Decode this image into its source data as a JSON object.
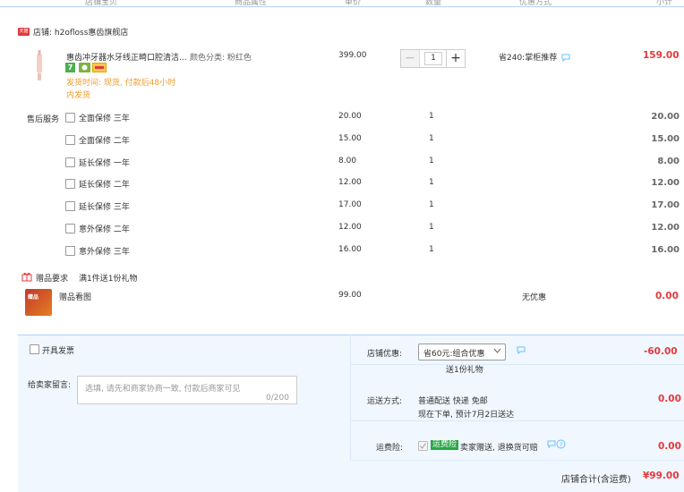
{
  "header": {
    "cols": [
      "店铺宝贝",
      "商品属性",
      "单价",
      "数量",
      "优惠方式",
      "小计"
    ]
  },
  "shop": {
    "badge": "天猫",
    "label": "店铺: h2ofloss惠齿旗舰店"
  },
  "product": {
    "title": "惠齿冲牙器水牙线正畸口腔清洁...",
    "attr": "颜色分类: 粉红色",
    "price": "399.00",
    "quantity": "1",
    "discount": "省240:掌柜推荐",
    "subtotal": "159.00",
    "ship_time": "发货时间: 现货, 付款后48小时",
    "ship_time_2": "内发货",
    "icon_names": [
      "7-day-return-icon",
      "guarantee-icon",
      "card-icon"
    ]
  },
  "after_sales": {
    "label": "售后服务",
    "items": [
      {
        "name": "全面保修 三年",
        "price": "20.00",
        "qty": "1",
        "subtotal": "20.00"
      },
      {
        "name": "全面保修 二年",
        "price": "15.00",
        "qty": "1",
        "subtotal": "15.00"
      },
      {
        "name": "延长保修 一年",
        "price": "8.00",
        "qty": "1",
        "subtotal": "8.00"
      },
      {
        "name": "延长保修 二年",
        "price": "12.00",
        "qty": "1",
        "subtotal": "12.00"
      },
      {
        "name": "延长保修 三年",
        "price": "17.00",
        "qty": "1",
        "subtotal": "17.00"
      },
      {
        "name": "意外保修 二年",
        "price": "12.00",
        "qty": "1",
        "subtotal": "12.00"
      },
      {
        "name": "意外保修 三年",
        "price": "16.00",
        "qty": "1",
        "subtotal": "16.00"
      }
    ]
  },
  "gift": {
    "label": "赠品要求",
    "requirement": "满1件送1份礼物",
    "name": "赠品看图",
    "price": "99.00",
    "discount": "无优惠",
    "subtotal": "0.00",
    "thumb_text": "赠品"
  },
  "footer": {
    "invoice_label": "开具发票",
    "message_label": "给卖家留言:",
    "message_placeholder": "选填, 请先和商家协商一致, 付款后商家可见",
    "message_counter": "0/200",
    "shop_discount_label": "店铺优惠:",
    "shop_discount_value": "省60元:组合优惠",
    "shop_discount_note": "送1份礼物",
    "shop_discount_amount": "-60.00",
    "delivery_label": "运送方式:",
    "delivery_value": "普通配送 快递 免邮",
    "delivery_note": "现在下单, 预计7月2日送达",
    "delivery_amount": "0.00",
    "insurance_label": "运费险:",
    "insurance_badge": "运费险",
    "insurance_value": "卖家赠送, 退换货可赔",
    "insurance_amount": "0.00",
    "total_label": "店铺合计(含运费)",
    "total_value": "¥99.00"
  },
  "colors": {
    "accent_red": "#e4393c",
    "orange": "#f09d2d",
    "footer_bg": "#f0f7ff",
    "green_badge": "#28a745"
  }
}
